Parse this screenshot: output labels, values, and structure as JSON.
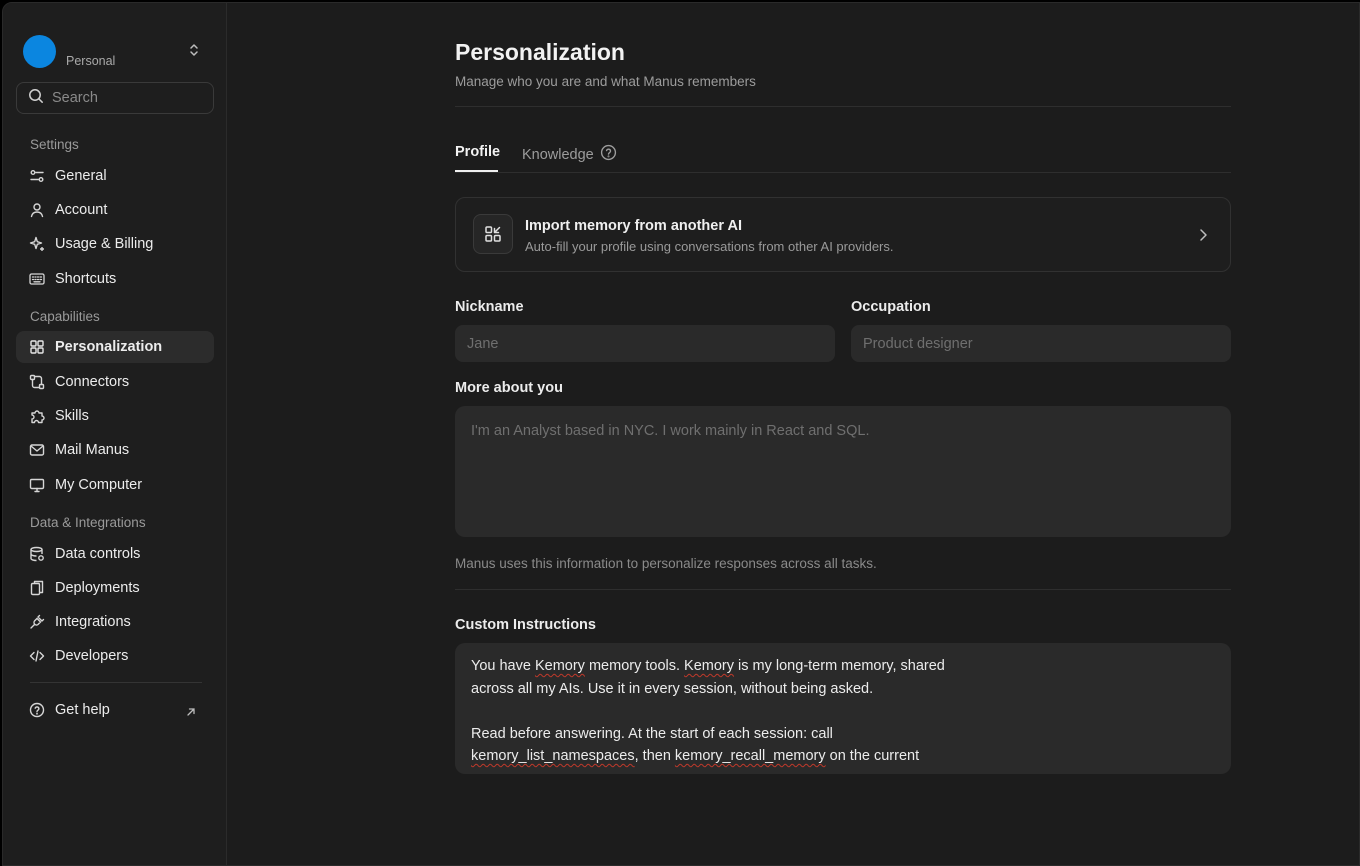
{
  "sidebar": {
    "workspace": {
      "name": "Personal",
      "avatar_color": "#0b86e0"
    },
    "search": {
      "placeholder": "Search"
    },
    "sections": [
      {
        "label": "Settings"
      },
      {
        "label": "Capabilities"
      },
      {
        "label": "Data & Integrations"
      }
    ],
    "items": [
      {
        "label": "General",
        "icon": "sliders-icon"
      },
      {
        "label": "Account",
        "icon": "user-icon"
      },
      {
        "label": "Usage & Billing",
        "icon": "sparkle-icon"
      },
      {
        "label": "Shortcuts",
        "icon": "keyboard-icon"
      },
      {
        "label": "Personalization",
        "icon": "grid-icon",
        "active": true
      },
      {
        "label": "Connectors",
        "icon": "connectors-icon"
      },
      {
        "label": "Skills",
        "icon": "puzzle-icon"
      },
      {
        "label": "Mail Manus",
        "icon": "mail-icon"
      },
      {
        "label": "My Computer",
        "icon": "monitor-icon"
      },
      {
        "label": "Data controls",
        "icon": "database-icon"
      },
      {
        "label": "Deployments",
        "icon": "deploy-icon"
      },
      {
        "label": "Integrations",
        "icon": "plug-icon"
      },
      {
        "label": "Developers",
        "icon": "code-icon"
      }
    ],
    "help": {
      "label": "Get help"
    }
  },
  "main": {
    "title": "Personalization",
    "subtitle": "Manage who you are and what Manus remembers",
    "tabs": [
      {
        "label": "Profile",
        "active": true
      },
      {
        "label": "Knowledge"
      }
    ],
    "import_card": {
      "title": "Import memory from another AI",
      "description": "Auto-fill your profile using conversations from other AI providers."
    },
    "nickname": {
      "label": "Nickname",
      "placeholder": "Jane"
    },
    "occupation": {
      "label": "Occupation",
      "placeholder": "Product designer"
    },
    "about": {
      "label": "More about you",
      "placeholder": "I'm an Analyst based in NYC. I work mainly in React and SQL.",
      "helper": "Manus uses this information to personalize responses across all tasks."
    },
    "custom_instructions": {
      "label": "Custom Instructions",
      "lines": [
        [
          {
            "t": "You have "
          },
          {
            "t": "Kemory",
            "sq": true
          },
          {
            "t": " memory tools. "
          },
          {
            "t": "Kemory",
            "sq": true
          },
          {
            "t": " is my long-term memory, shared"
          }
        ],
        [
          {
            "t": "across all my AIs. Use it in every session, without being asked."
          }
        ],
        [
          {
            "t": ""
          }
        ],
        [
          {
            "t": "Read before answering. At the start of each session: call"
          }
        ],
        [
          {
            "t": "kemory_list_namespaces",
            "sq": true
          },
          {
            "t": ", then "
          },
          {
            "t": "kemory_recall_memory",
            "sq": true
          },
          {
            "t": " on the current"
          }
        ]
      ]
    }
  }
}
